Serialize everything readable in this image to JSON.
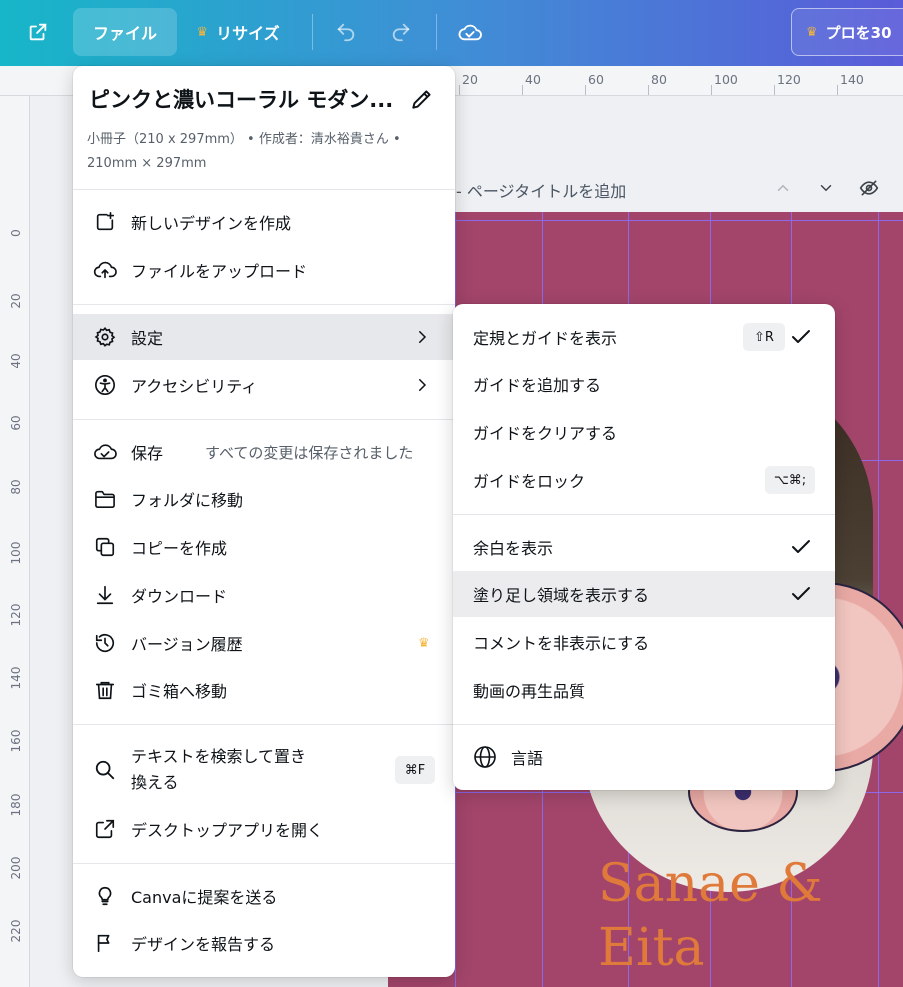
{
  "toolbar": {
    "file_label": "ファイル",
    "resize_label": "リサイズ",
    "pro_label": "プロを30"
  },
  "ruler": {
    "top_labels": [
      "20",
      "40",
      "60",
      "80",
      "100",
      "120",
      "140"
    ],
    "left_labels": [
      "0",
      "20",
      "40",
      "60",
      "80",
      "100",
      "120",
      "140",
      "160",
      "180",
      "200",
      "220"
    ]
  },
  "page_header": {
    "add_title": "- ページタイトルを追加"
  },
  "canvas": {
    "names": [
      "Sanae &",
      "Eita"
    ]
  },
  "file_menu": {
    "title": "ピンクと濃いコーラル モダン...",
    "subtitle_line1": "小冊子（210 x 297mm） • 作成者：清水裕貴さん •",
    "subtitle_line2": "210mm × 297mm",
    "new_design": "新しいデザインを作成",
    "upload": "ファイルをアップロード",
    "settings": "設定",
    "accessibility": "アクセシビリティ",
    "save": "保存",
    "save_status": "すべての変更は保存されました",
    "move_folder": "フォルダに移動",
    "make_copy": "コピーを作成",
    "download": "ダウンロード",
    "version_history": "バージョン履歴",
    "trash": "ゴミ箱へ移動",
    "find_replace_1": "テキストを検索して置き",
    "find_replace_2": "換える",
    "find_shortcut": "⌘F",
    "open_desktop": "デスクトップアプリを開く",
    "send_feedback": "Canvaに提案を送る",
    "report_design": "デザインを報告する"
  },
  "settings_menu": {
    "show_rulers": "定規とガイドを表示",
    "show_rulers_shortcut": "⇧R",
    "add_guides": "ガイドを追加する",
    "clear_guides": "ガイドをクリアする",
    "lock_guides": "ガイドをロック",
    "lock_guides_shortcut": "⌥⌘;",
    "show_margins": "余白を表示",
    "show_bleed": "塗り足し領域を表示する",
    "hide_comments": "コメントを非表示にする",
    "video_quality": "動画の再生品質",
    "language": "言語"
  },
  "colors": {
    "toolbar_start": "#17b6c8",
    "toolbar_end": "#5a5bd8",
    "page_background": "#a3456b",
    "crown": "#f6b53a"
  }
}
